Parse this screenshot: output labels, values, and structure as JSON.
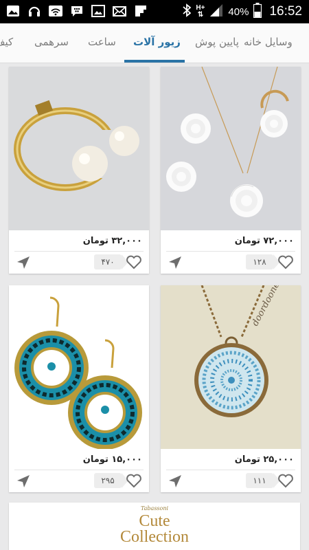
{
  "status_bar": {
    "battery_percent": "40%",
    "time": "16:52",
    "network_type": "H+",
    "left_icons": [
      "gallery-icon",
      "headphones-icon",
      "wifi-icon",
      "bbm-icon",
      "image-icon",
      "mail-icon",
      "flipboard-icon"
    ]
  },
  "tabs": [
    {
      "label": "وسایل خانه"
    },
    {
      "label": "پایین پوش"
    },
    {
      "label": "زیور آلات"
    },
    {
      "label": "ساعت"
    },
    {
      "label": "سرهمی"
    },
    {
      "label": "کیف"
    }
  ],
  "active_tab_index": 2,
  "colors": {
    "accent": "#2a73a6",
    "tab_text": "#7c7c7c",
    "background": "#e9e9ea"
  },
  "products": [
    {
      "price": "۷۲,۰۰۰ تومان",
      "likes": "۱۲۸",
      "image": "rose-necklace-earrings-ring"
    },
    {
      "price": "۳۲,۰۰۰ تومان",
      "likes": "۴۷۰",
      "image": "gold-pearl-cuff-bracelet"
    },
    {
      "price": "۲۵,۰۰۰ تومان",
      "likes": "۱۱۱",
      "image": "mandala-pendant-necklace",
      "watermark": "doordooneh2"
    },
    {
      "price": "۱۵,۰۰۰ تومان",
      "likes": "۲۹۵",
      "image": "turquoise-hoop-earrings"
    }
  ],
  "banner": {
    "small_text": "Tabassoni",
    "line1": "Cute",
    "line2": "Collection"
  }
}
